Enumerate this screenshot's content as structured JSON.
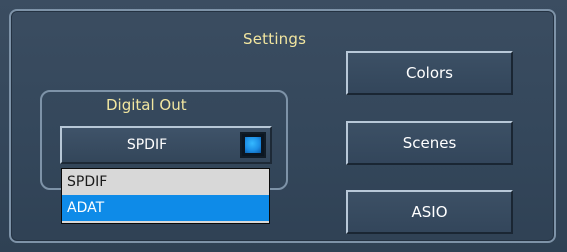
{
  "settings": {
    "title": "Settings"
  },
  "digital_out": {
    "title": "Digital Out",
    "selected_value": "SPDIF",
    "options": [
      "SPDIF",
      "ADAT"
    ],
    "highlighted_option": "ADAT"
  },
  "buttons": {
    "colors_label": "Colors",
    "scenes_label": "Scenes",
    "asio_label": "ASIO"
  },
  "colors": {
    "title_text": "#f2e6a0",
    "highlight": "#0e8be8",
    "indicator": "#1d8fe6"
  }
}
